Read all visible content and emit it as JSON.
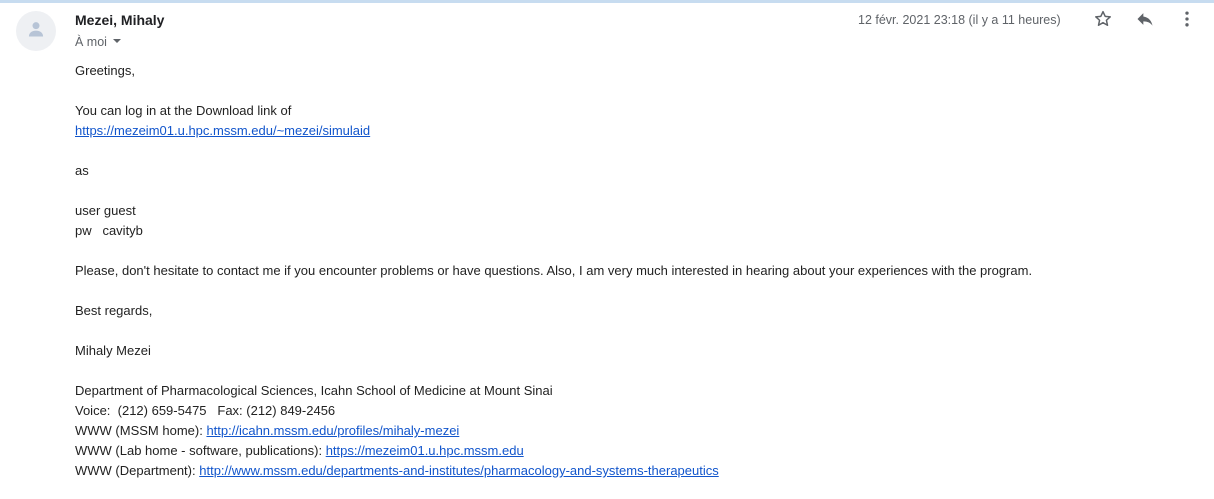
{
  "header": {
    "sender": "Mezei, Mihaly",
    "recipient_label": "À moi",
    "date": "12 févr. 2021 23:18 (il y a 11 heures)"
  },
  "icons": {
    "avatar": "person-icon",
    "star": "star-outline-icon",
    "reply": "reply-icon",
    "more": "more-vert-icon",
    "recipient_dropdown": "caret-down-icon"
  },
  "colors": {
    "link": "#1155cc",
    "text": "#222222",
    "muted": "#5f6368"
  },
  "message": {
    "greeting": "Greetings,",
    "login_intro": "You can log in at the Download link of",
    "login_link": "https://mezeim01.u.hpc.mssm.edu/~mezei/simulaid",
    "as": "as",
    "user_line": "user guest",
    "pw_line": "pw   cavityb",
    "contact": "Please, don't hesitate to contact me if you encounter problems or have questions. Also, I am very much interested in hearing about your experiences with the program.",
    "closing": "Best regards,",
    "name": "Mihaly Mezei"
  },
  "signature": {
    "department": "Department of Pharmacological Sciences, Icahn School of Medicine at Mount Sinai",
    "phones": "Voice:  (212) 659-5475   Fax: (212) 849-2456",
    "mssm_label": "WWW (MSSM home): ",
    "mssm_link": "http://icahn.mssm.edu/profiles/mihaly-mezei",
    "lab_label": "WWW (Lab home - software, publications): ",
    "lab_link": "https://mezeim01.u.hpc.mssm.edu",
    "dept_label": "WWW (Department): ",
    "dept_link": "http://www.mssm.edu/departments-and-institutes/pharmacology-and-systems-therapeutics"
  }
}
